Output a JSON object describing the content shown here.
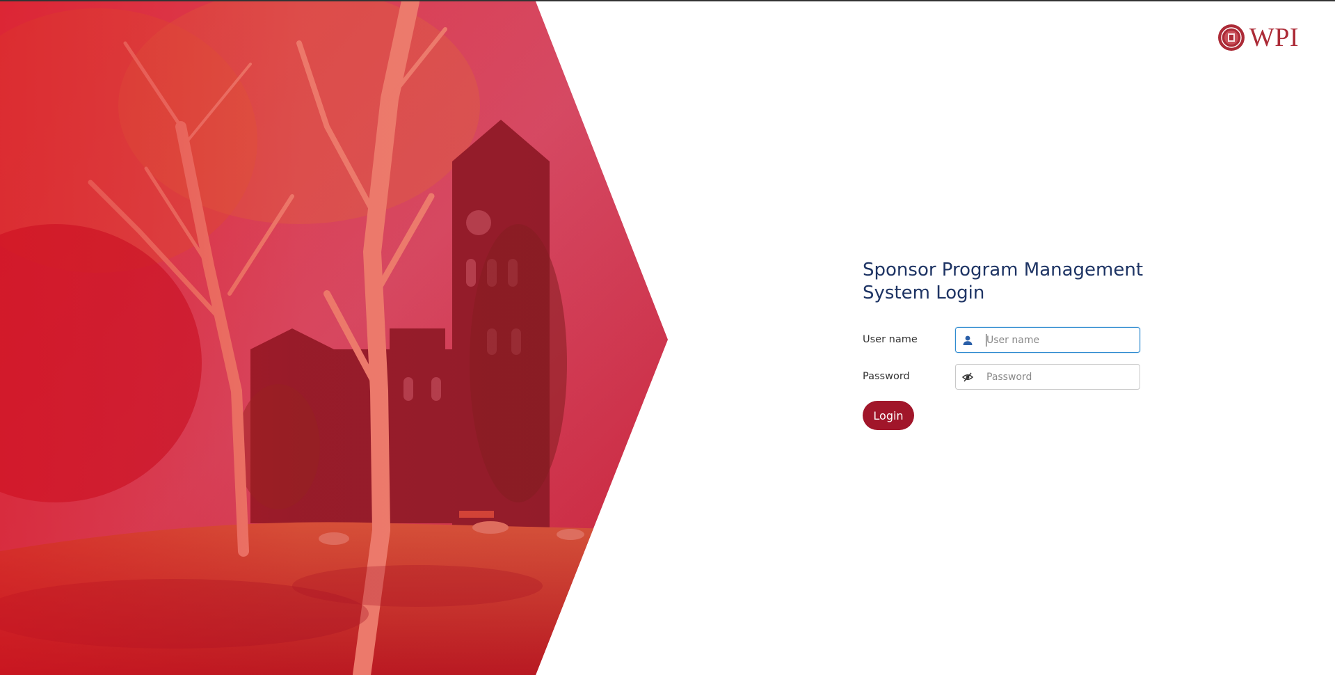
{
  "brand": {
    "logo_text": "WPI",
    "accent_color": "#ac2b37"
  },
  "login": {
    "title": "Sponsor Program Management System Login",
    "username": {
      "label": "User name",
      "placeholder": "User name",
      "value": "",
      "icon": "user-icon"
    },
    "password": {
      "label": "Password",
      "placeholder": "Password",
      "value": "",
      "icon": "eye-slash-icon"
    },
    "submit_label": "Login",
    "button_color": "#a1162a",
    "title_color": "#1e3464"
  }
}
